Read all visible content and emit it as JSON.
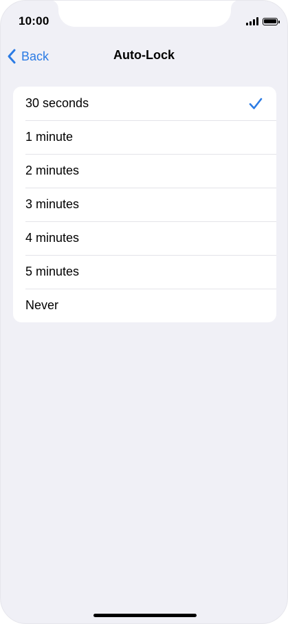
{
  "status_bar": {
    "time": "10:00",
    "icons": [
      "signal-icon",
      "battery-icon"
    ]
  },
  "nav": {
    "back_label": "Back",
    "title": "Auto-Lock",
    "back_icon": "chevron-left-icon"
  },
  "options": {
    "items": [
      {
        "label": "30 seconds",
        "selected": true
      },
      {
        "label": "1 minute",
        "selected": false
      },
      {
        "label": "2 minutes",
        "selected": false
      },
      {
        "label": "3 minutes",
        "selected": false
      },
      {
        "label": "4 minutes",
        "selected": false
      },
      {
        "label": "5 minutes",
        "selected": false
      },
      {
        "label": "Never",
        "selected": false
      }
    ],
    "selected_icon": "checkmark-icon"
  },
  "colors": {
    "accent": "#2b7be4",
    "background": "#f0f0f6",
    "card": "#ffffff",
    "separator": "#e3e3e8",
    "text": "#000000"
  }
}
